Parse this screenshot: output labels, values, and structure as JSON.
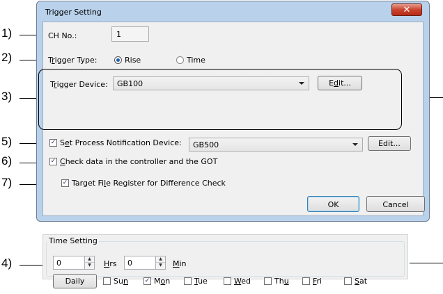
{
  "window": {
    "title": "Trigger Setting",
    "close_glyph": "✕"
  },
  "callouts": [
    "1)",
    "2)",
    "3)",
    "5)",
    "6)",
    "7)",
    "4)"
  ],
  "ch_no": {
    "label": "CH No.:",
    "value": "1"
  },
  "trigger_type": {
    "label_pre": "T",
    "label_ul": "r",
    "label_post": "igger Type:",
    "option_rise": "Rise",
    "option_time": "Time",
    "selected": "Rise"
  },
  "trigger_device": {
    "label_pre": "T",
    "label_ul": "r",
    "label_post": "igger Device:",
    "value": "GB100",
    "edit_pre": "E",
    "edit_ul": "d",
    "edit_post": "it..."
  },
  "process_notification": {
    "checked": true,
    "label_pre": "S",
    "label_ul": "e",
    "label_post": "t Process Notification Device:",
    "value": "GB500",
    "edit_label": "Edit..."
  },
  "check_data": {
    "checked": true,
    "label_ul": "C",
    "label_post": "heck data in the controller and the GOT"
  },
  "target_file": {
    "checked": true,
    "label_pre": "Target Fi",
    "label_ul": "l",
    "label_post": "e Register for Difference Check"
  },
  "buttons": {
    "ok": "OK",
    "cancel": "Cancel"
  },
  "time_setting": {
    "title": "Time Setting",
    "hours_value": "0",
    "hours_label_ul": "H",
    "hours_label_post": "rs",
    "minutes_value": "0",
    "minutes_label_ul": "M",
    "minutes_label_post": "in",
    "daily_label": "Daily",
    "days": [
      {
        "pre": "Su",
        "ul": "n",
        "post": "",
        "checked": false
      },
      {
        "pre": "M",
        "ul": "o",
        "post": "n",
        "checked": true
      },
      {
        "pre": "",
        "ul": "T",
        "post": "ue",
        "checked": false
      },
      {
        "pre": "",
        "ul": "W",
        "post": "ed",
        "checked": false
      },
      {
        "pre": "Th",
        "ul": "u",
        "post": "",
        "checked": false
      },
      {
        "pre": "",
        "ul": "F",
        "post": "ri",
        "checked": false
      },
      {
        "pre": "",
        "ul": "S",
        "post": "at",
        "checked": false
      }
    ]
  }
}
